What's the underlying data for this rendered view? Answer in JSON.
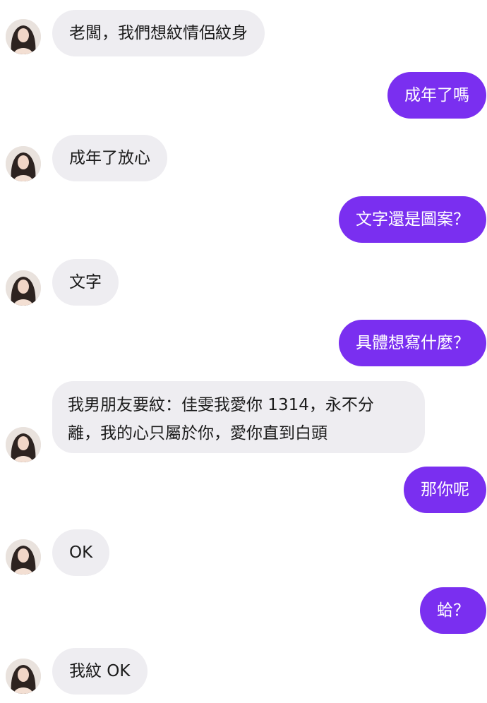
{
  "conversation": {
    "messages": [
      {
        "sender": "other",
        "text": "老闆，我們想紋情侶紋身"
      },
      {
        "sender": "me",
        "text": "成年了嗎"
      },
      {
        "sender": "other",
        "text": "成年了放心"
      },
      {
        "sender": "me",
        "text": "文字還是圖案？"
      },
      {
        "sender": "other",
        "text": "文字"
      },
      {
        "sender": "me",
        "text": "具體想寫什麼？"
      },
      {
        "sender": "other",
        "lines": [
          "我男朋友要紋：佳雯我愛你 1314，永不分",
          "離，我的心只屬於你，愛你直到白頭"
        ]
      },
      {
        "sender": "me",
        "text": "那你呢"
      },
      {
        "sender": "other",
        "text": "OK"
      },
      {
        "sender": "me",
        "text": "蛤？"
      },
      {
        "sender": "other",
        "text": "我紋 OK"
      }
    ]
  },
  "colors": {
    "incoming_bubble": "#eeedf1",
    "outgoing_bubble": "#7a2ff0",
    "outgoing_text": "#ffffff"
  },
  "icons": {
    "avatar": "contact-avatar-photo"
  }
}
